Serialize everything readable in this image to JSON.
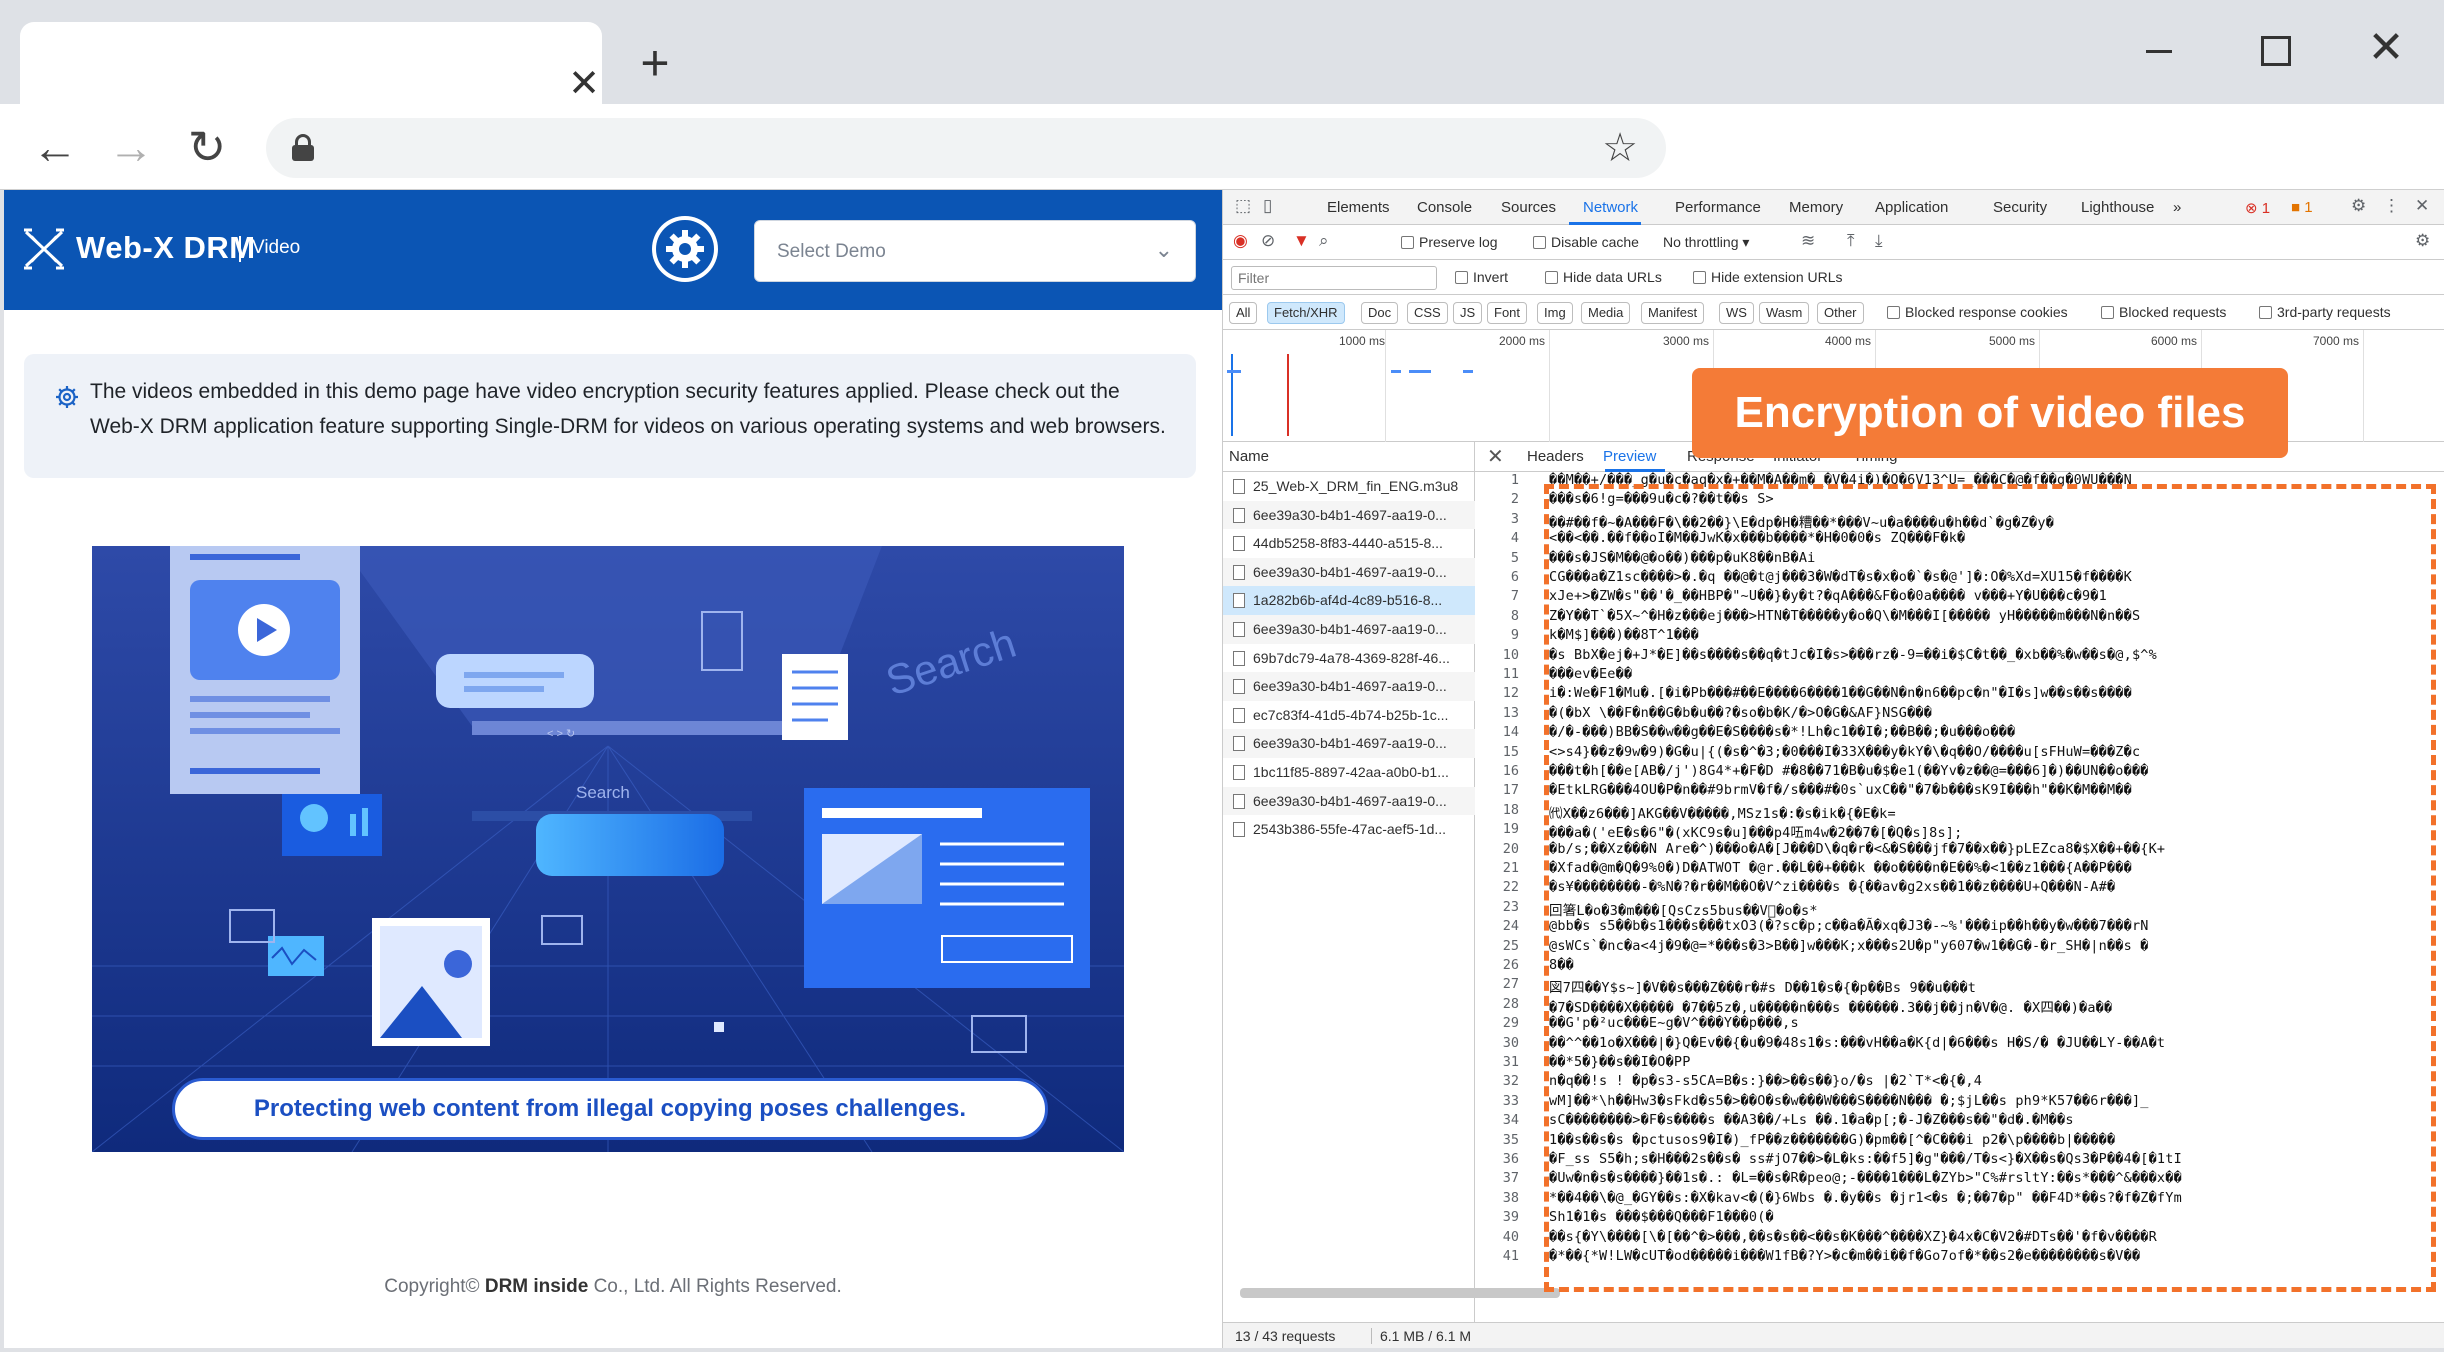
{
  "browser": {
    "tab_close": "✕",
    "new_tab": "+",
    "window_close": "✕",
    "nav_back": "←",
    "nav_forward": "→",
    "nav_reload": "↻",
    "bookmark_star": "☆"
  },
  "site": {
    "logo_text": "Web-X DRM",
    "logo_sub": "Video",
    "select_placeholder": "Select Demo",
    "notice": "The videos embedded in this demo page have video encryption security features applied. Please check out the Web-X DRM application feature supporting Single-DRM for videos on various operating systems and web browsers.",
    "hero_caption": "Protecting web content from illegal copying poses challenges.",
    "hero_search": "Search",
    "hero_overlay": "Search",
    "copyright_prefix": "Copyright© ",
    "copyright_brand": "DRM inside",
    "copyright_suffix": " Co., Ltd. All Rights Reserved."
  },
  "devtools": {
    "tabs": [
      "Elements",
      "Console",
      "Sources",
      "Network",
      "Performance",
      "Memory",
      "Application",
      "Security",
      "Lighthouse"
    ],
    "more_tabs": "»",
    "errors": "1",
    "warnings": "1",
    "preserve_log": "Preserve log",
    "disable_cache": "Disable cache",
    "throttling": "No throttling",
    "filter_placeholder": "Filter",
    "invert": "Invert",
    "hide_data_urls": "Hide data URLs",
    "hide_extension_urls": "Hide extension URLs",
    "types": [
      "All",
      "Fetch/XHR",
      "Doc",
      "CSS",
      "JS",
      "Font",
      "Img",
      "Media",
      "Manifest",
      "WS",
      "Wasm",
      "Other"
    ],
    "blocked_cookies": "Blocked response cookies",
    "blocked_requests": "Blocked requests",
    "third_party": "3rd-party requests",
    "timeline_labels": [
      "1000 ms",
      "2000 ms",
      "3000 ms",
      "4000 ms",
      "5000 ms",
      "6000 ms",
      "7000 ms"
    ],
    "name_header": "Name",
    "requests": [
      "25_Web-X_DRM_fin_ENG.m3u8",
      "6ee39a30-b4b1-4697-aa19-0...",
      "44db5258-8f83-4440-a515-8...",
      "6ee39a30-b4b1-4697-aa19-0...",
      "1a282b6b-af4d-4c89-b516-8...",
      "6ee39a30-b4b1-4697-aa19-0...",
      "69b7dc79-4a78-4369-828f-46...",
      "6ee39a30-b4b1-4697-aa19-0...",
      "ec7c83f4-41d5-4b74-b25b-1c...",
      "6ee39a30-b4b1-4697-aa19-0...",
      "1bc11f85-8897-42aa-a0b0-b1...",
      "6ee39a30-b4b1-4697-aa19-0...",
      "2543b386-55fe-47ac-aef5-1d..."
    ],
    "detail_close": "✕",
    "detail_tabs": [
      "Headers",
      "Preview",
      "Response",
      "Initiator",
      "Timing"
    ],
    "status_requests": "13 / 43 requests",
    "status_size": "6.1 MB / 6.1 M",
    "callout": "Encryption of video files",
    "code_lines": [
      "��M��+/���_g�u�c�aq�x�+��M�A��m�_�V�4i�)�Q�6V13^U=_���C�@�f��g�0WU���N",
      "���s�6!g=���9u�c�?��t��s S>",
      "��#��f�~�A���F�\\��2��}\\E�dp�H�糟��*���V~u�a����u�h��d`�g�Z�y�",
      "<��<��.��f��oI�M��JwK�x���b����*�H�0�0�s ZQ���F�k�",
      "���s�JS�M��@�o��)���p�uK8��nB�Ai",
      "CG���a�Z1sc����>�.�q   ��@�t@j���3�W�dT�s�x�o�`�s�@']�:O�%Xd=XU15�f����K",
      "xJe+>�ZW�s\"��'�_��HBP�\"~U��}�y�t?�qA���&F�o�0a���� v���+Y�U���c�9�1",
      "Z�Y��T`�5X~^�H�z���ej���>HTN�T�����y�o�Q\\�M���I[�����  yH�����m���N�n��S",
      "k�M$]���)��8T^1���",
      "�s BbX�ej�+J*�E]��s����s��q�tJc�I�s>���rz�-9=��i�$C�t��_�xb��%�w��s�@,$^%",
      "���ev�Ee��",
      "i�:We�F1�Mu�.[�i�Pb���#��E����6����1��G��N�n�n6��pc�n\"�I�s]w��s��s����",
      "�(�bX \\��F�n��G�b�u��?�so�b�K/�>O�G�&AF}NSG���",
      "�/�-���)BB�S��w��g��E�S����s�*!Lh�c1��I�;��B��;�u���o���",
      "<>s4}��z�9w�9)�G�u|{(�s�^�3;�0���I�33X���y�kY�\\�q��O/����u[sFHuW=���Z�c",
      "���t�h[��e[AB�/j')8G4*+�F�D #�8��71�B�u�$�e1(��Yv�z��@=���6]�)��UN��o���",
      "�EtkLRG���4OU�P�n��#9brmV�f�/s���#�0s`uxC��\"�7�b���sK9I���h\"��K�M��M��",
      "㈹X��z6���]AKG��V�����,MSz1s�:�s�ik�{�E�k=",
      "���a�('eE�s�6\"�(xKC9s�u]���p4㕶m4w�2��7�[�Q�s]8s];",
      "�b/s;��Xz���N Are�^)���o�A�[J���D\\�q�r�<&�S���jf�7��x��}pLEZca8�$X��+��{K+",
      "�Xfad�@m�Q�9%0�)D�ATWOT �@r.��L��+���k ��o����n�E��%�<1��z1���{A��P���",
      "�s¥��������-�%N�?�r��M��O�V^zi����s �{��av�g2xs��1��z����U+Q���N-A#�",
      "回箸L�o�3�m���[QsCzs5bus��V⃝�o�s*",
      "@bb�s s5��b�s1���s���txO3(�?sc�p;c��a�Ã�xq�J3�-~%'���ip��h��y�w���7���rN",
      "@sWCs`�nc�a<4j�9�@=*���s�3>B��]w���K;x���s2U�p\"y607�w1��G�-�r_SH�|n��s �",
      "8��",
      "図7四��Y$s~]�V��s���Z���r�#s D��1�s�{�p��Bs 9��u���t",
      "�7�SD����X����� �7��5z�,u�����n���s ������.3��j��jn�V�@. �X四��)�a��",
      "��G'p�²uc���E~g�V^���Y��p���,s",
      "��^^��1o�X���|�}Q�Ev��{�u�9�48s1�s:���vH��a�K{d|�6���s H�S/� �JU��LY-��A�t",
      "��*5�}��s��I�O�PP",
      "n�q��!s ! �p�s3-s5CA=B�s:}��>��s��}o/�s |�2`T*<�{�,4",
      "wM]��*\\h��Hw3�sFkd�s5�>��O�s�w���W���S����N��� �;$jL��s ph9*K57��6r���]_",
      "sC��������>�F�s����s ��A3��/+Ls  ��.1�a�p[;�-J�Z���s��\"�d�.�M��s",
      "1��s��s�s �pctusos9�I�)_fP��z�������G)�pm��[^�C���i  p2�\\p����b|�����",
      "�F_ss S5�h;s�H���2s��s� ss#jO7��>�L�ks:��f5]�g\"���/T�s<}�X��s�Qs3�P��4�[�1tI",
      "�Uw�n�s�s����}��1s�.:   �L=��s�R�peo@;-����1���L�ZYb>\"C%#rsltY:��s*���^&���x��",
      "*��4��\\�@_�GY��s:�X�kav<�(�}6Wbs �.�y��s �jr1<�s �;��7�p\" ��F4D*��s?�f�Z�fYm",
      "Sh1�1�s ���$���Q���F1���0(�",
      "��s{�Y\\����[\\�[��^�>���,��s�s��<��s�K���^����XZ}�4x�C�V2�#DTs��'�f�v����R",
      "�*��{*W!LW�cUT�od�����i���W1fB�?Y>�c�m��i��f�Go7of�*��s2�e��������s�V��"
    ]
  }
}
